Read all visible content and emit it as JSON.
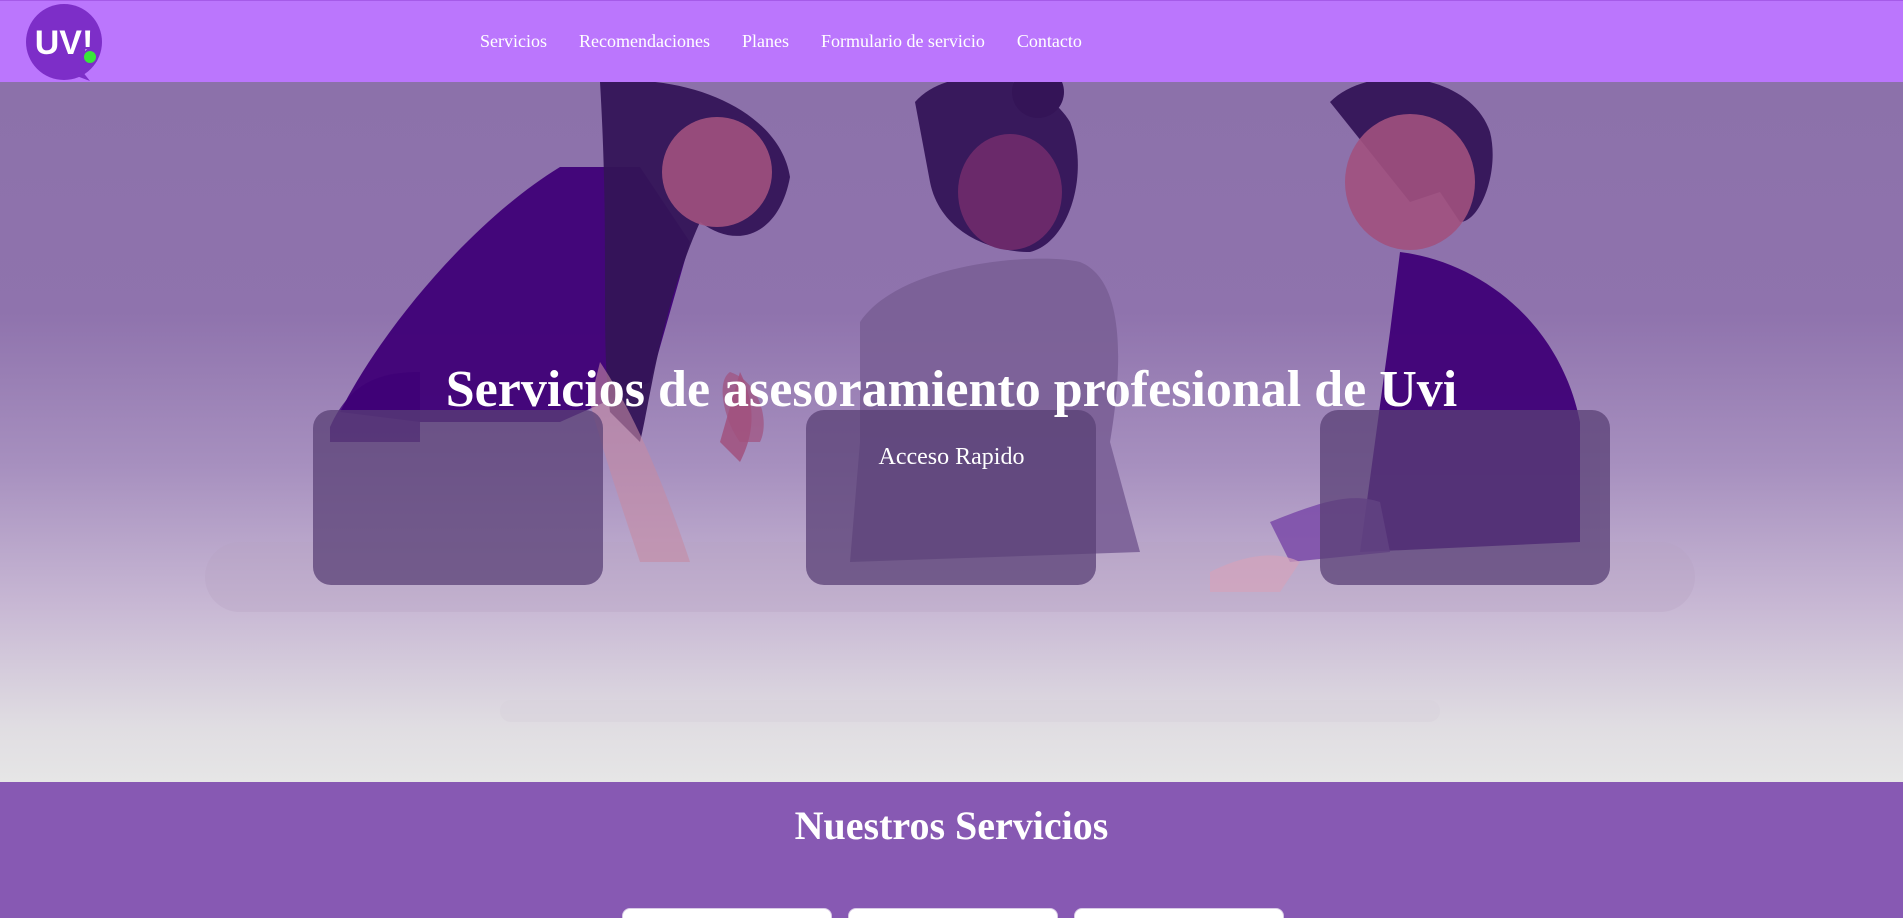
{
  "brand": {
    "logo_text": "UV!",
    "logo_color": "#7d2ec8",
    "logo_dot_color": "#39e639"
  },
  "nav": {
    "items": [
      {
        "label": "Servicios"
      },
      {
        "label": "Recomendaciones"
      },
      {
        "label": "Planes"
      },
      {
        "label": "Formulario de servicio"
      },
      {
        "label": "Contacto"
      }
    ]
  },
  "hero": {
    "title": "Servicios de asesoramiento profesional de Uvi",
    "subtitle": "Acceso Rapido"
  },
  "services": {
    "title": "Nuestros Servicios"
  },
  "colors": {
    "navbar": "#bb76fd",
    "services_bg": "#8759b3",
    "text": "#ffffff"
  }
}
